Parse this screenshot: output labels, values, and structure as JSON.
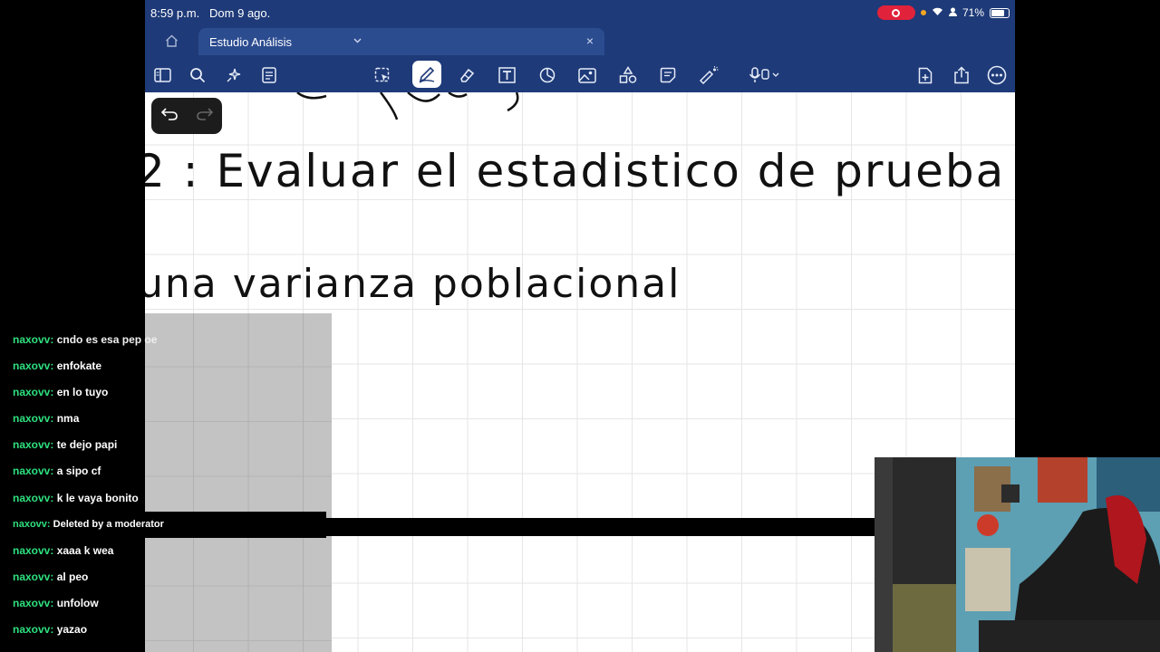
{
  "status_bar": {
    "time": "8:59 p.m.",
    "date": "Dom 9 ago.",
    "battery": "71%"
  },
  "tab": {
    "title": "Estudio Análisis",
    "close": "×"
  },
  "toolbar": {
    "icons": [
      "sidebar-icon",
      "search-icon",
      "sparkle-icon",
      "list-icon",
      "lasso-icon",
      "pen-icon",
      "eraser-icon",
      "text-icon",
      "shapes-icon",
      "image-icon",
      "elements-icon",
      "sticky-note-icon",
      "laser-icon",
      "mic-icon",
      "add-page-icon",
      "share-icon",
      "more-icon"
    ]
  },
  "notes": {
    "line1": "2 : Evaluar el estadistico de prueba .",
    "line2": "una varianza poblacional"
  },
  "chat": [
    {
      "user": "naxovv:",
      "text": "cndo es esa pep oe"
    },
    {
      "user": "naxovv:",
      "text": "enfokate"
    },
    {
      "user": "naxovv:",
      "text": "en lo tuyo"
    },
    {
      "user": "naxovv:",
      "text": "nma"
    },
    {
      "user": "naxovv:",
      "text": "te dejo papi"
    },
    {
      "user": "naxovv:",
      "text": "a sipo cf"
    },
    {
      "user": "naxovv:",
      "text": "k le vaya bonito"
    },
    {
      "user": "naxovv:",
      "text": "Deleted by a moderator"
    },
    {
      "user": "naxovv:",
      "text": "xaaa k wea"
    },
    {
      "user": "naxovv:",
      "text": "al peo"
    },
    {
      "user": "naxovv:",
      "text": "unfolow"
    },
    {
      "user": "naxovv:",
      "text": "yazao"
    }
  ]
}
